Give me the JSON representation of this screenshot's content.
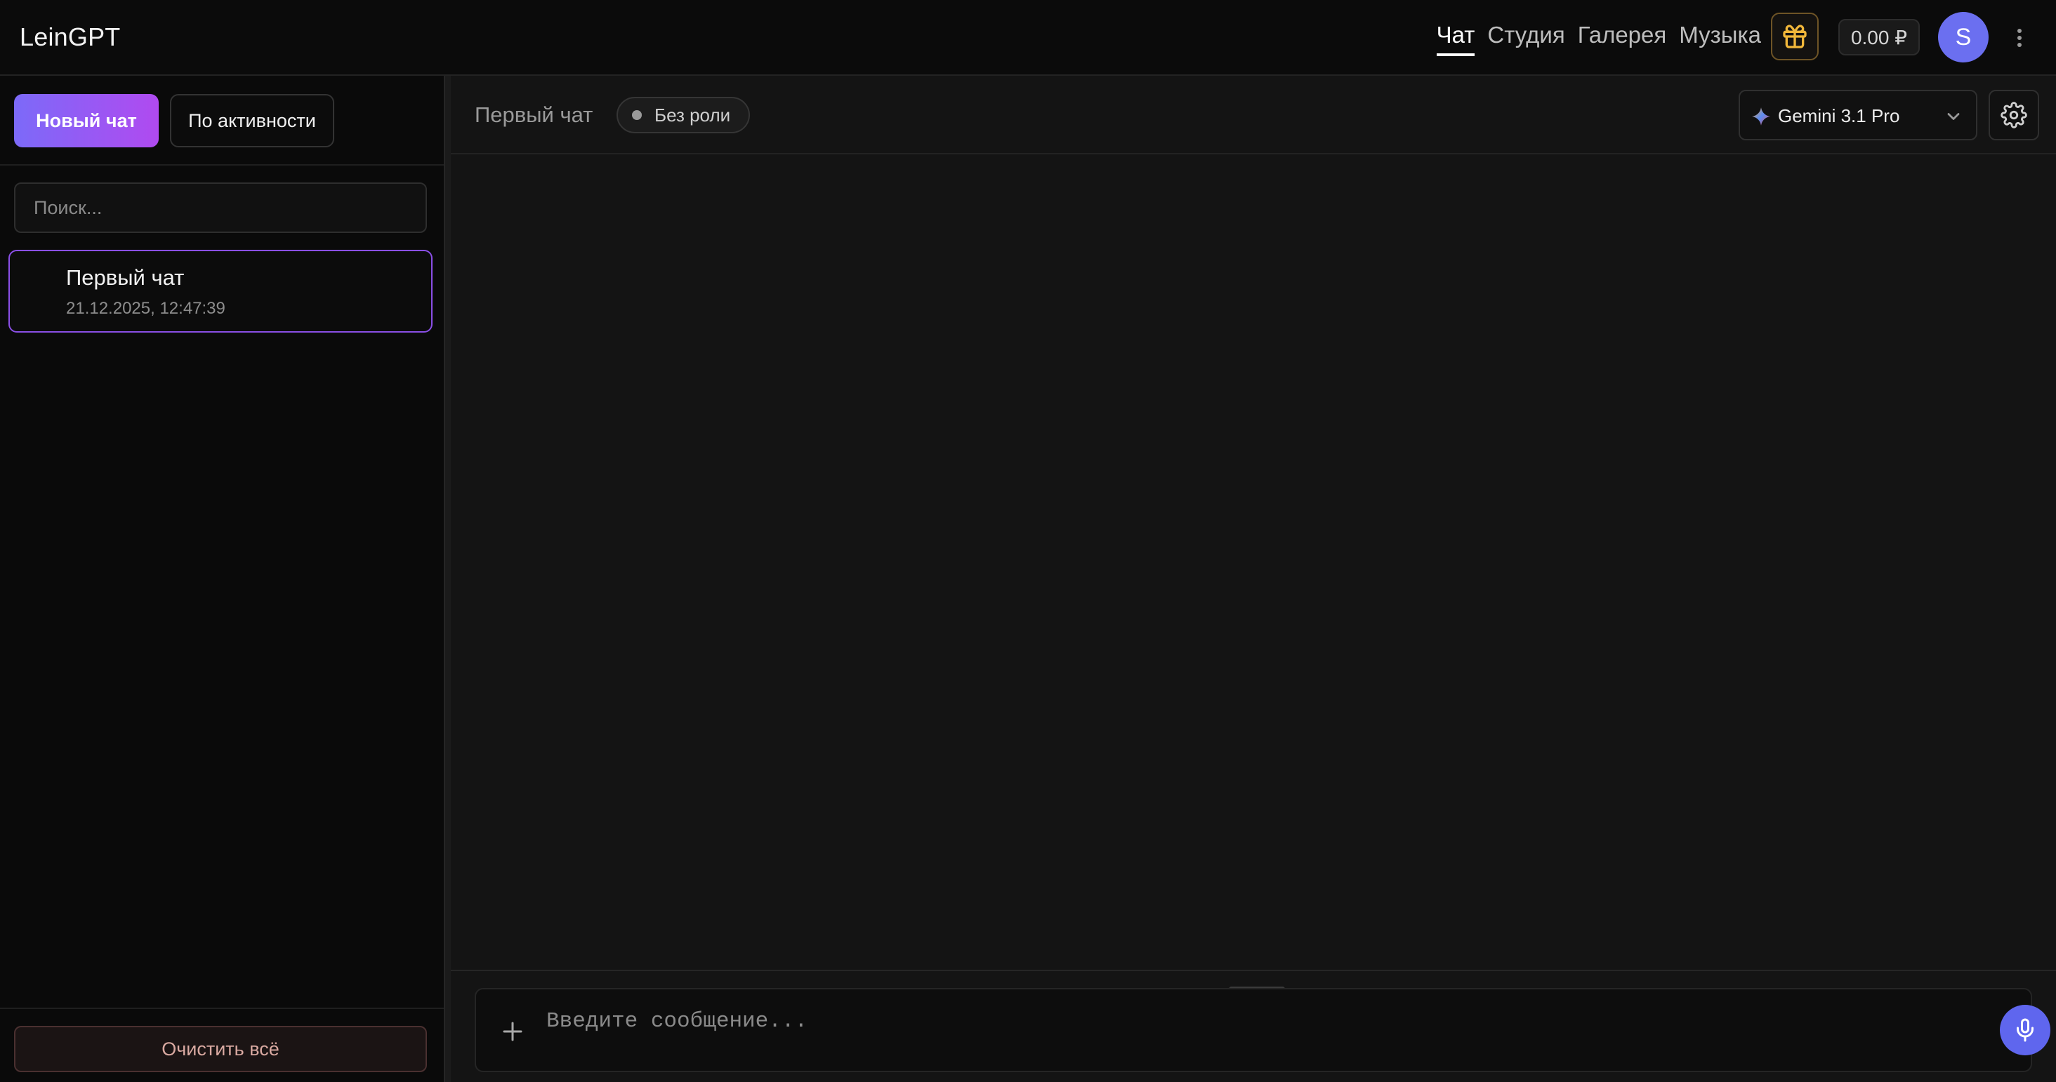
{
  "header": {
    "brand": "LeinGPT",
    "nav": [
      {
        "label": "Чат",
        "active": true
      },
      {
        "label": "Студия",
        "active": false
      },
      {
        "label": "Галерея",
        "active": false
      },
      {
        "label": "Музыка",
        "active": false
      }
    ],
    "balance": "0.00 ₽",
    "avatar_initial": "S",
    "icons": {
      "gift": "gift-icon",
      "menu": "more-vertical-icon"
    },
    "colors": {
      "gift_accent": "#f1b73a",
      "avatar_bg": "#6b6ff0"
    }
  },
  "sidebar": {
    "new_chat_label": "Новый чат",
    "sort_label": "По активности",
    "search_placeholder": "Поиск...",
    "chats": [
      {
        "title": "Первый чат",
        "date": "21.12.2025, 12:47:39",
        "selected": true
      }
    ],
    "clear_all_label": "Очистить всё",
    "colors": {
      "new_chat_gradient_start": "#7c6af8",
      "new_chat_gradient_end": "#b04af0",
      "selected_border": "#8a4fe6"
    }
  },
  "chat": {
    "title": "Первый чат",
    "role_badge": "Без роли",
    "model_label": "Gemini 3.1 Pro",
    "message_placeholder": "Введите сообщение...",
    "icons": {
      "model": "gemini-sparkle-icon",
      "dropdown": "chevron-down-icon",
      "settings": "gear-icon",
      "attach": "plus-icon",
      "mic": "microphone-icon"
    },
    "colors": {
      "mic_bg": "#5f66ee"
    }
  }
}
